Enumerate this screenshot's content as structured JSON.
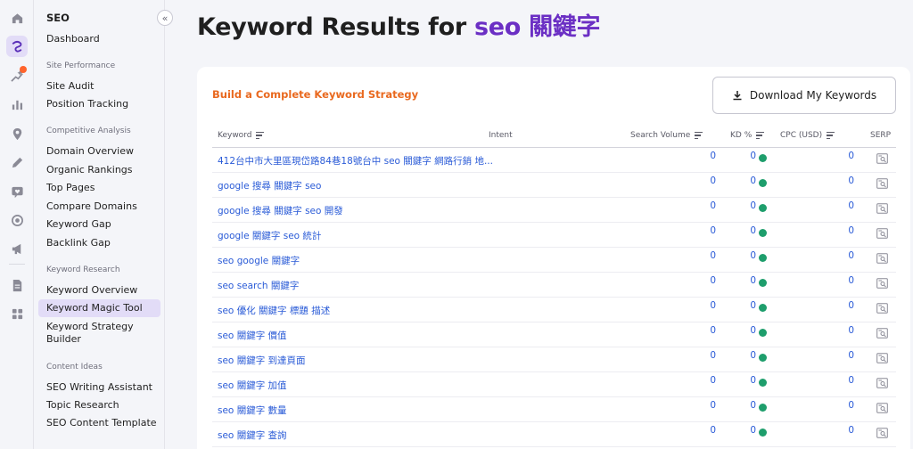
{
  "sidebar": {
    "title": "SEO",
    "dashboard": "Dashboard",
    "groups": [
      {
        "label": "Site Performance",
        "items": [
          "Site Audit",
          "Position Tracking"
        ]
      },
      {
        "label": "Competitive Analysis",
        "items": [
          "Domain Overview",
          "Organic Rankings",
          "Top Pages",
          "Compare Domains",
          "Keyword Gap",
          "Backlink Gap"
        ]
      },
      {
        "label": "Keyword Research",
        "items": [
          "Keyword Overview",
          "Keyword Magic Tool",
          "Keyword Strategy",
          "Builder"
        ]
      },
      {
        "label": "Content Ideas",
        "items": [
          "SEO Writing Assistant",
          "Topic Research",
          "SEO Content Template"
        ]
      }
    ],
    "collapse_icon": "«",
    "active_item": "Keyword Magic Tool"
  },
  "rail": {
    "icons": [
      "home-icon",
      "seo-icon",
      "sparkle-chart-icon",
      "bar-chart-icon",
      "location-pin-icon",
      "pen-icon",
      "chat-heart-icon",
      "target-icon",
      "megaphone-icon",
      "document-icon",
      "grid-icon"
    ],
    "notification_color": "#ff642d"
  },
  "header": {
    "title_prefix": "Keyword Results for ",
    "title_query": "seo 關鍵字"
  },
  "card": {
    "strategy_link": "Build a Complete Keyword Strategy",
    "download_label": "Download My Keywords"
  },
  "table": {
    "columns": {
      "keyword": "Keyword",
      "intent": "Intent",
      "volume": "Search Volume",
      "kd": "KD %",
      "cpc": "CPC (USD)",
      "serp": "SERP"
    },
    "rows": [
      {
        "keyword": "412台中市大里區現岱路84巷18號台中 seo 關鍵字 網路行銷 地...",
        "volume": "0",
        "kd": "0",
        "cpc": "0"
      },
      {
        "keyword": "google 搜尋 關鍵字 seo",
        "volume": "0",
        "kd": "0",
        "cpc": "0"
      },
      {
        "keyword": "google 搜尋 關鍵字 seo 開發",
        "volume": "0",
        "kd": "0",
        "cpc": "0"
      },
      {
        "keyword": "google 關鍵字 seo 統計",
        "volume": "0",
        "kd": "0",
        "cpc": "0"
      },
      {
        "keyword": "seo google 關鍵字",
        "volume": "0",
        "kd": "0",
        "cpc": "0"
      },
      {
        "keyword": "seo search 關鍵字",
        "volume": "0",
        "kd": "0",
        "cpc": "0"
      },
      {
        "keyword": "seo 優化 關鍵字 標題 描述",
        "volume": "0",
        "kd": "0",
        "cpc": "0"
      },
      {
        "keyword": "seo 關鍵字 價值",
        "volume": "0",
        "kd": "0",
        "cpc": "0"
      },
      {
        "keyword": "seo 關鍵字 到達頁面",
        "volume": "0",
        "kd": "0",
        "cpc": "0"
      },
      {
        "keyword": "seo 關鍵字 加值",
        "volume": "0",
        "kd": "0",
        "cpc": "0"
      },
      {
        "keyword": "seo 關鍵字 數量",
        "volume": "0",
        "kd": "0",
        "cpc": "0"
      },
      {
        "keyword": "seo 關鍵字 查詢",
        "volume": "0",
        "kd": "0",
        "cpc": "0"
      }
    ],
    "kd_color": "#1e9e6c",
    "link_color": "#2a5bd7"
  },
  "colors": {
    "accent": "#6b2fc4",
    "orange": "#e9691f",
    "active_bg": "#e2dcf7"
  }
}
